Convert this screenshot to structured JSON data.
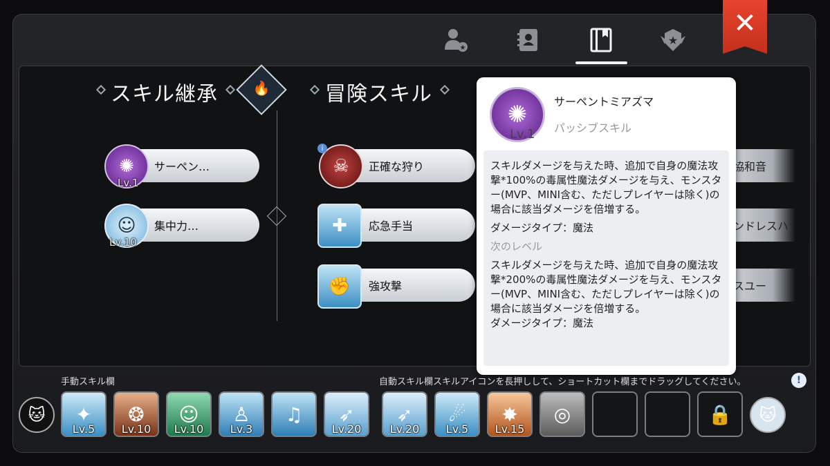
{
  "header": {
    "tabs": [
      {
        "icon": "character-star-icon"
      },
      {
        "icon": "contacts-book-icon"
      },
      {
        "icon": "skill-book-icon",
        "active": true
      },
      {
        "icon": "winged-star-badge-icon"
      }
    ],
    "close_label": "✕"
  },
  "sections": {
    "inherit_title": "スキル継承",
    "adventure_title": "冒険スキル"
  },
  "inherit_skills": [
    {
      "name": "サーペン…",
      "level": "Lv.1"
    },
    {
      "name": "集中力…",
      "level": "Lv.10"
    }
  ],
  "adventure_skills": [
    {
      "name": "正確な狩り"
    },
    {
      "name": "応急手当"
    },
    {
      "name": "強攻撃"
    }
  ],
  "right_skills": [
    {
      "name": "協和音"
    },
    {
      "name": "ンドレスハ"
    },
    {
      "name": "スユー"
    }
  ],
  "popup": {
    "skill_name": "サーペントミアズマ",
    "skill_type": "パッシブスキル",
    "level": "Lv.1",
    "current_desc": "スキルダメージを与えた時、追加で自身の魔法攻撃*100%の毒属性魔法ダメージを与え、モンスター(MVP、MINI含む、ただしプレイヤーは除く)の場合に該当ダメージを倍増する。",
    "current_damage_type": "ダメージタイプ：魔法",
    "next_level_label": "次のレベル",
    "next_desc": "スキルダメージを与えた時、追加で自身の魔法攻撃*200%の毒属性魔法ダメージを与え、モンスター(MVP、MINI含む、ただしプレイヤーは除く)の場合に該当ダメージを倍増する。",
    "next_damage_type": "ダメージタイプ：魔法"
  },
  "skill_bar": {
    "manual_label": "手動スキル欄",
    "auto_hint": "自動スキル欄スキルアイコンを長押しして、ショートカット欄までドラッグしてください。",
    "slots": [
      {
        "level": "Lv.5"
      },
      {
        "level": "Lv.10"
      },
      {
        "level": "Lv.10"
      },
      {
        "level": "Lv.3"
      },
      {
        "level": ""
      },
      {
        "level": "Lv.20"
      },
      {
        "level": "Lv.20"
      },
      {
        "level": "Lv.5"
      },
      {
        "level": "Lv.15"
      },
      {
        "level": ""
      }
    ]
  }
}
